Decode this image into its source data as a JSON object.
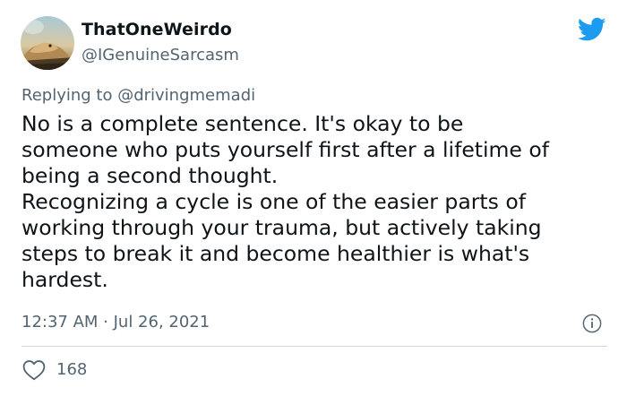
{
  "user": {
    "display_name": "ThatOneWeirdo",
    "handle": "@IGenuineSarcasm"
  },
  "reply": {
    "prefix": "Replying to ",
    "to_handle": "@drivingmemadi"
  },
  "tweet": {
    "paragraph_1": "No is a complete sentence. It's okay to be\nsomeone who puts yourself first after a lifetime of\nbeing a second thought.",
    "paragraph_2": "Recognizing a cycle is one of the easier parts of\nworking through your trauma, but actively taking\nsteps to break it and become healthier is what's\nhardest."
  },
  "meta": {
    "timestamp": "12:37 AM · Jul 26, 2021"
  },
  "stats": {
    "likes": "168"
  },
  "icons": {
    "brand": "twitter-bird-icon",
    "info": "info-icon",
    "like": "heart-icon"
  },
  "colors": {
    "twitter_blue": "#1d9bf0",
    "secondary_text": "#536471",
    "primary_text": "#0f1419",
    "divider": "#cfd9de"
  }
}
